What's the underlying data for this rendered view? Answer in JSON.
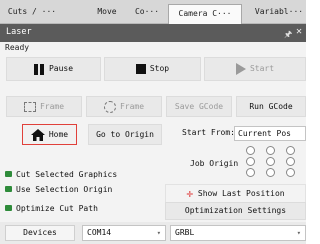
{
  "tabs": [
    "Cuts / ···",
    "Move",
    "Co···",
    "Camera C···",
    "Variabl···"
  ],
  "window": {
    "title": "Laser",
    "pin_icon": "pin-icon",
    "close_label": "✕"
  },
  "status": "Ready",
  "controls": {
    "pause": "Pause",
    "stop": "Stop",
    "start": "Start",
    "frame": "Frame",
    "frame_round": "Frame",
    "save_gcode": "Save GCode",
    "run_gcode": "Run GCode",
    "home": "Home",
    "go_to_origin": "Go to Origin"
  },
  "start_from": {
    "label": "Start From:",
    "value": "Current Pos"
  },
  "job_origin": {
    "label": "Job Origin"
  },
  "options": {
    "cut_selected": "Cut Selected Graphics",
    "use_selection_origin": "Use Selection Origin",
    "optimize_cut_path": "Optimize Cut Path"
  },
  "show_last_position": "Show Last Position",
  "optimization_settings": "Optimization Settings",
  "devices": {
    "label": "Devices",
    "port": "COM14",
    "controller": "GRBL"
  },
  "colors": {
    "accent_check": "#2e8b3a",
    "highlight_border": "#e0403a",
    "titlebar": "#5b5b5b"
  }
}
